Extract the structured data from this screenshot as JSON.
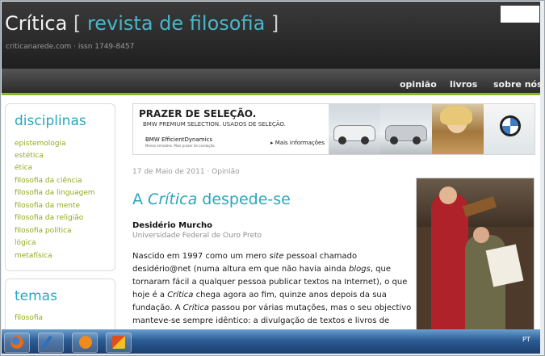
{
  "header": {
    "title_main": "Crítica",
    "bracket_open": "[",
    "title_sub": "revista de filosofia",
    "bracket_close": "]",
    "issn": "criticanarede.com · issn 1749-8457"
  },
  "nav": {
    "items": [
      "opinião",
      "livros",
      "sobre nós"
    ]
  },
  "sidebar": {
    "disciplinas_title": "disciplinas",
    "disciplinas": [
      "epistemologia",
      "estética",
      "ética",
      "filosofia da ciência",
      "filosofia da linguagem",
      "filosofia da mente",
      "filosofia da religião",
      "filosofia política",
      "lógica",
      "metafísica"
    ],
    "temas_title": "temas",
    "temas": [
      "filosofia"
    ]
  },
  "ad": {
    "headline": "PRAZER DE SELEÇÃO.",
    "subline": "BMW PREMIUM SELECTION. USADOS DE SELEÇÃO.",
    "brand": "BMW EfficientDynamics",
    "tagline": "Menos emissões. Mais prazer de condução.",
    "more": "Mais informações"
  },
  "article": {
    "meta": "17 de Maio de 2011 · Opinião",
    "title_a": "A ",
    "title_b": "Crítica",
    "title_c": " despede-se",
    "author": "Desidério Murcho",
    "affiliation": "Universidade Federal de Ouro Preto",
    "lines": [
      [
        "Nascido em 1997 como um mero ",
        "site",
        " pessoal chamado"
      ],
      [
        "desidério@net (numa altura em que não havia ainda ",
        "blogs",
        ", que"
      ],
      [
        "tornaram fácil a qualquer pessoa publicar textos na Internet), o que"
      ],
      [
        "hoje é a ",
        "Crítica",
        " chega agora ao fim, quinze anos depois da sua"
      ],
      [
        "fundação. A ",
        "Crítica",
        " passou por várias mutações, mas o seu objectivo"
      ],
      [
        "manteve-se sempre idêntico: a divulgação de textos e livros de"
      ]
    ]
  },
  "taskbar": {
    "language": "PT"
  },
  "colors": {
    "accent": "#2aa6c0",
    "link": "#93ab1f",
    "nav_border": "#8bb82b"
  }
}
